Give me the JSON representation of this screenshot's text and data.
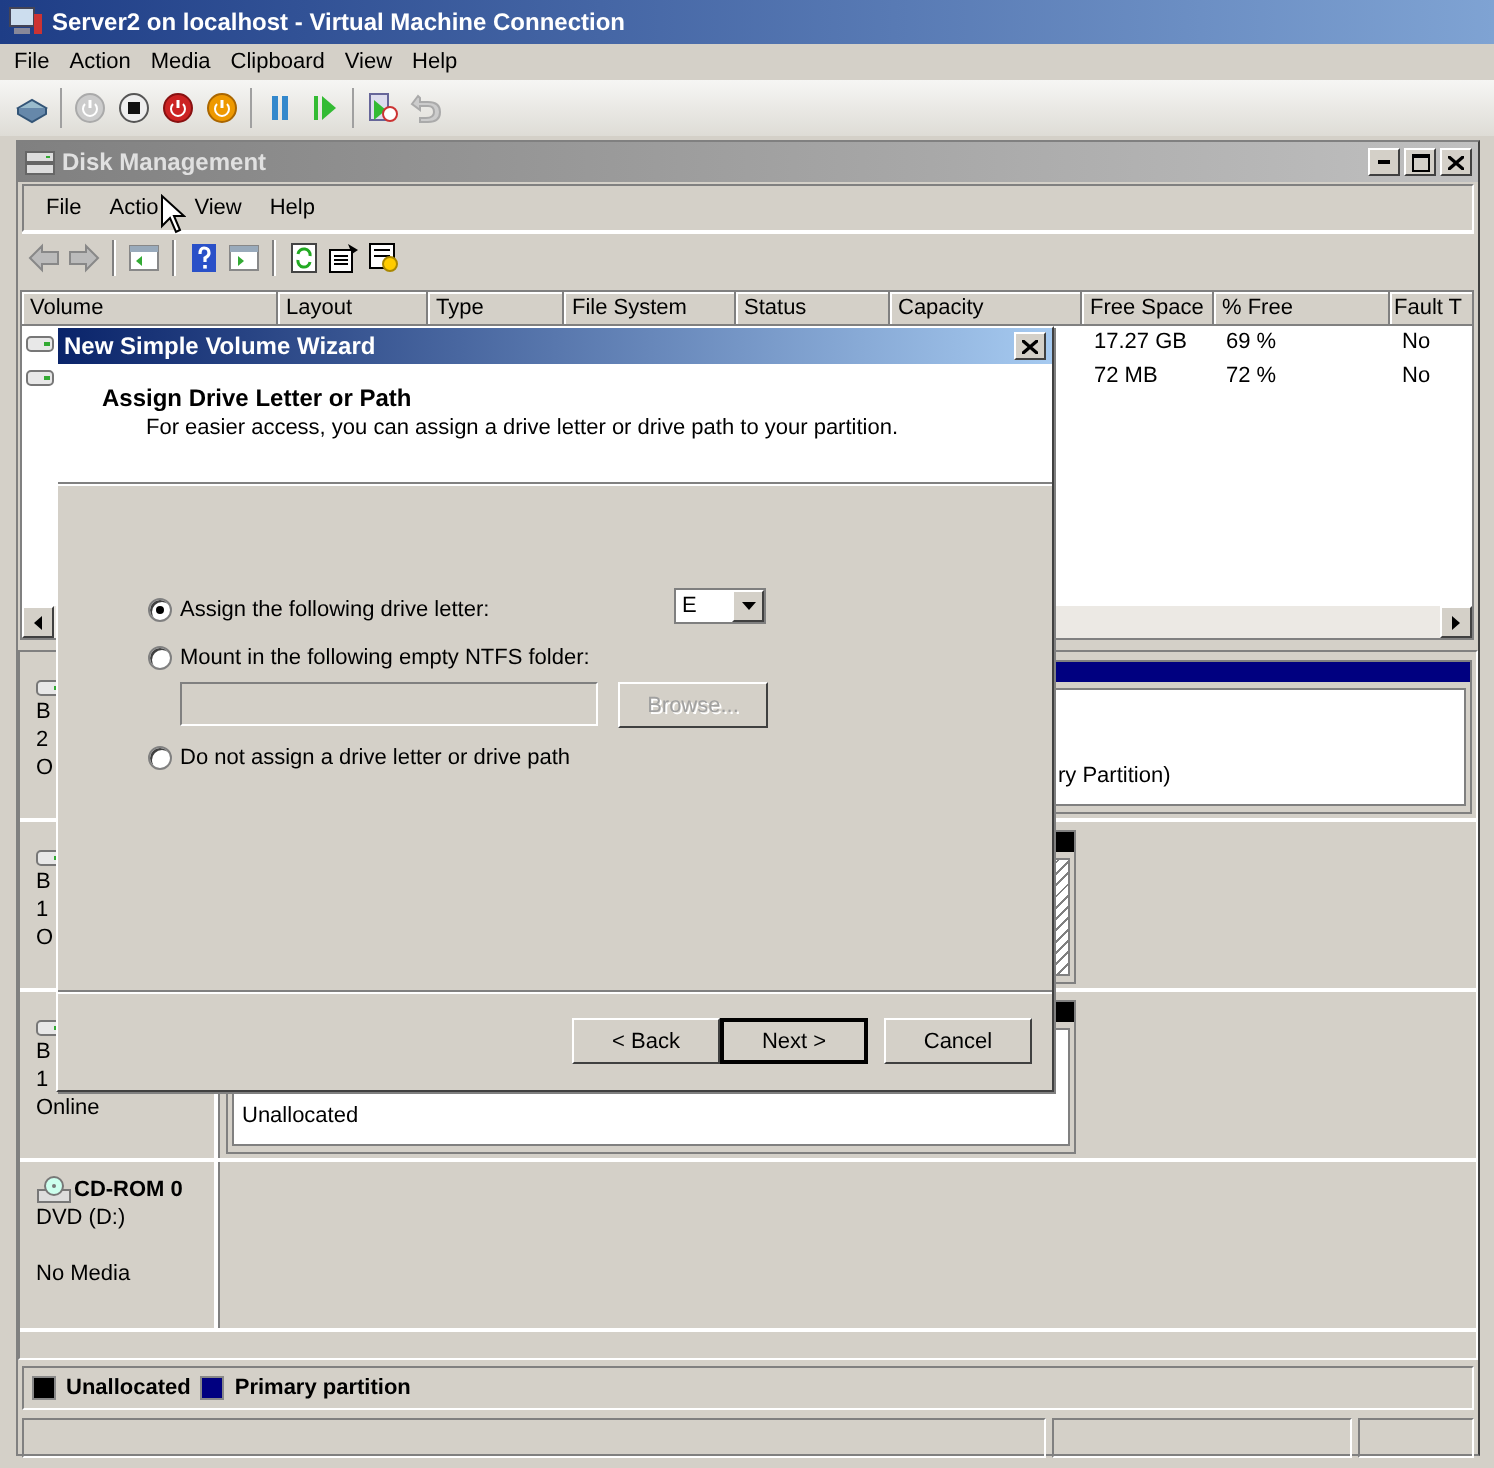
{
  "window": {
    "title": "Server2 on localhost - Virtual Machine Connection"
  },
  "menu": [
    "File",
    "Action",
    "Media",
    "Clipboard",
    "View",
    "Help"
  ],
  "disk_management": {
    "title": "Disk Management",
    "menu": [
      "File",
      "Actio",
      "View",
      "Help"
    ],
    "columns": [
      "Volume",
      "Layout",
      "Type",
      "File System",
      "Status",
      "Capacity",
      "Free Space",
      "% Free",
      "Fault T"
    ],
    "rows": [
      {
        "free_space": "17.27 GB",
        "percent_free": "69 %",
        "fault_tolerance": "No"
      },
      {
        "free_space": "72 MB",
        "percent_free": "72 %",
        "fault_tolerance": "No"
      }
    ],
    "disks": [
      {
        "kind": "disk",
        "name": "B",
        "size": "2",
        "status": "O",
        "partitions": [
          {
            "kind": "primary",
            "color": "#000080",
            "selected": false,
            "text": "ry Partition)"
          }
        ]
      },
      {
        "kind": "disk",
        "name": "B",
        "size": "1",
        "status": "O",
        "partitions": [
          {
            "kind": "unallocated",
            "color": "#000000",
            "selected": true
          }
        ]
      },
      {
        "kind": "disk",
        "name": "B",
        "size": "1",
        "status": "Online",
        "partitions": [
          {
            "kind": "unallocated",
            "color": "#000000",
            "selected": false,
            "text": "Unallocated"
          }
        ]
      },
      {
        "kind": "cdrom",
        "name": "CD-ROM 0",
        "size": "DVD (D:)",
        "status": "No Media"
      }
    ],
    "legend": [
      {
        "label": "Unallocated",
        "color": "#000000"
      },
      {
        "label": "Primary partition",
        "color": "#000080"
      }
    ]
  },
  "wizard": {
    "title": "New Simple Volume Wizard",
    "heading": "Assign Drive Letter or Path",
    "subtitle": "For easier access, you can assign a drive letter or drive path to your partition.",
    "options": [
      {
        "label": "Assign the following drive letter:",
        "selected": true
      },
      {
        "label": "Mount in the following empty NTFS folder:",
        "selected": false
      },
      {
        "label": "Do not assign a drive letter or drive path",
        "selected": false
      }
    ],
    "drive_letter": "E",
    "folder_field": {
      "disabled": true
    },
    "browse": {
      "label": "Browse...",
      "disabled": true
    },
    "buttons": [
      {
        "label": "< Back",
        "default": false
      },
      {
        "label": "Next >",
        "default": true
      },
      {
        "label": "Cancel",
        "default": false
      }
    ]
  }
}
